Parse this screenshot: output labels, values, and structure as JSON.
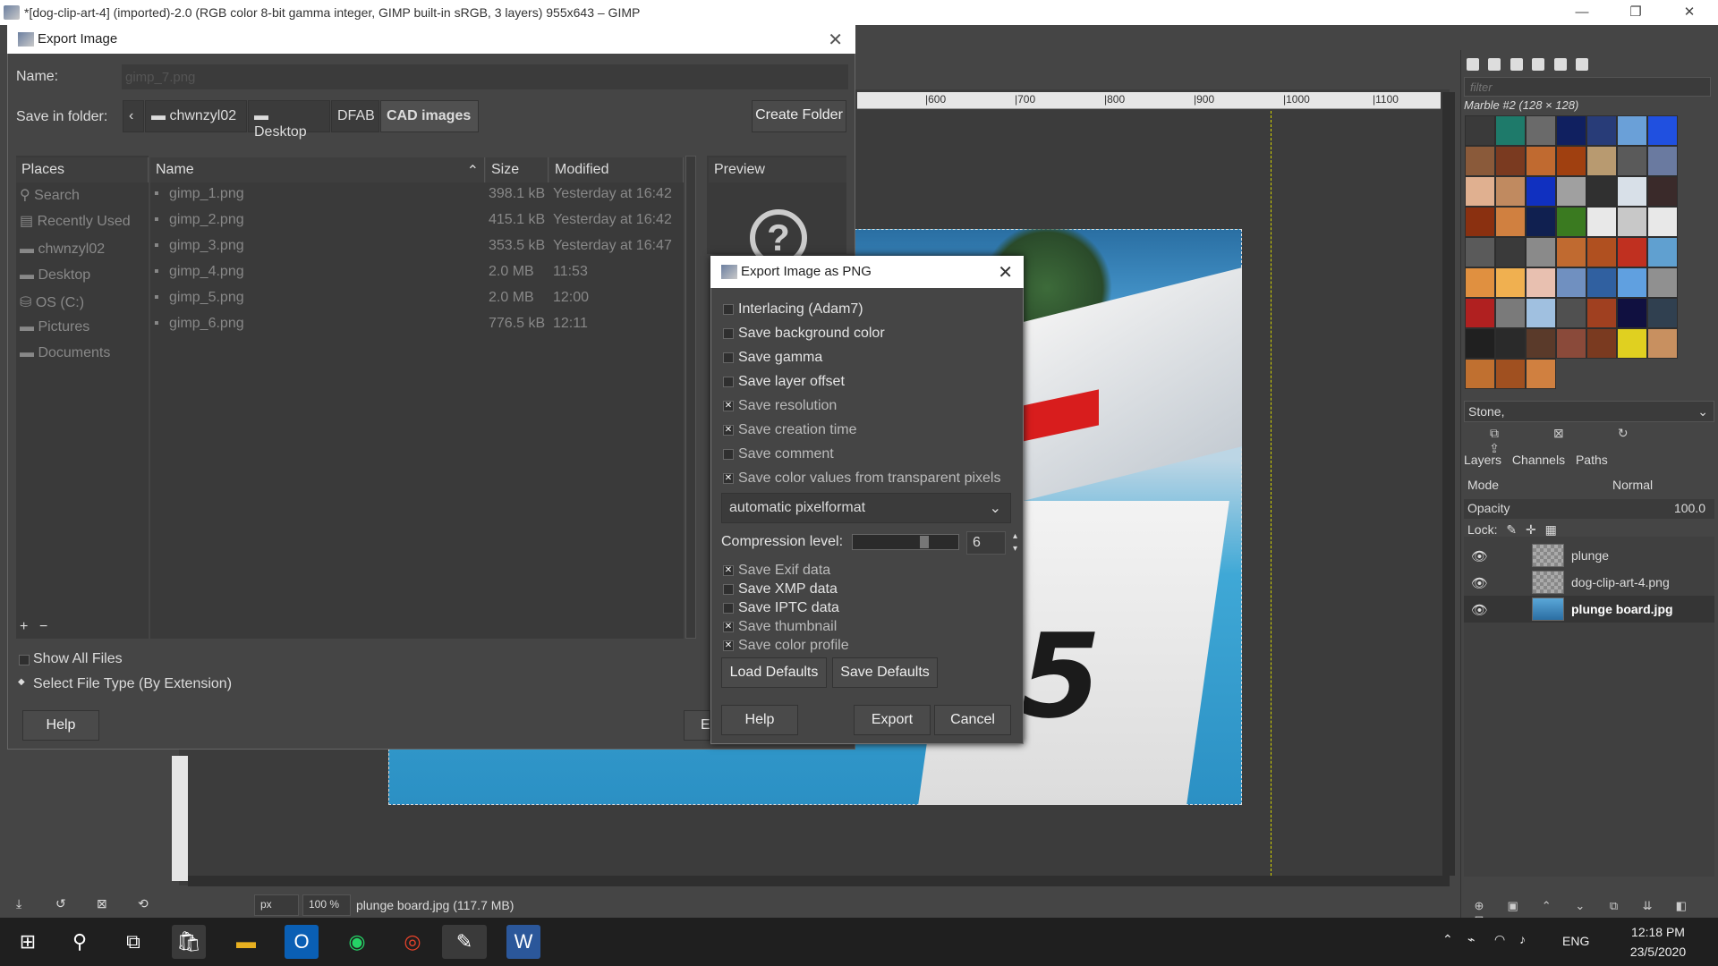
{
  "window": {
    "title": "*[dog-clip-art-4] (imported)-2.0 (RGB color 8-bit gamma integer, GIMP built-in sRGB, 3 layers) 955x643 – GIMP",
    "minimize": "—",
    "restore": "❐",
    "close": "✕"
  },
  "ruler": {
    "ticks": [
      "|600",
      "|700",
      "|800",
      "|900",
      "|1000",
      "|1100"
    ]
  },
  "status": {
    "unit": "px",
    "zoom": "100 %",
    "text": "plunge board.jpg (117.7 MB)"
  },
  "export_dialog": {
    "title": "Export Image",
    "name_label": "Name:",
    "name_value": "gimp_7.png",
    "folder_label": "Save in folder:",
    "crumbs": [
      "chwnzyl02",
      "Desktop",
      "DFAB",
      "CAD images"
    ],
    "create_folder": "Create Folder",
    "places_header": "Places",
    "places": [
      "Search",
      "Recently Used",
      "chwnzyl02",
      "Desktop",
      "OS (C:)",
      "Pictures",
      "Documents"
    ],
    "columns": {
      "name": "Name",
      "size": "Size",
      "modified": "Modified"
    },
    "files": [
      {
        "name": "gimp_1.png",
        "size": "398.1 kB",
        "modified": "Yesterday at 16:42"
      },
      {
        "name": "gimp_2.png",
        "size": "415.1 kB",
        "modified": "Yesterday at 16:42"
      },
      {
        "name": "gimp_3.png",
        "size": "353.5 kB",
        "modified": "Yesterday at 16:47"
      },
      {
        "name": "gimp_4.png",
        "size": "2.0 MB",
        "modified": "11:53"
      },
      {
        "name": "gimp_5.png",
        "size": "2.0 MB",
        "modified": "12:00"
      },
      {
        "name": "gimp_6.png",
        "size": "776.5 kB",
        "modified": "12:11"
      }
    ],
    "preview_header": "Preview",
    "show_all_files": "Show All Files",
    "select_file_type": "Select File Type (By Extension)",
    "help": "Help",
    "export_partial": "E"
  },
  "png_dialog": {
    "title": "Export Image as PNG",
    "options": [
      {
        "label": "Interlacing (Adam7)",
        "checked": false
      },
      {
        "label": "Save background color",
        "checked": false
      },
      {
        "label": "Save gamma",
        "checked": false
      },
      {
        "label": "Save layer offset",
        "checked": false
      },
      {
        "label": "Save resolution",
        "checked": true
      },
      {
        "label": "Save creation time",
        "checked": true
      },
      {
        "label": "Save comment",
        "checked": false
      },
      {
        "label": "Save color values from transparent pixels",
        "checked": true
      }
    ],
    "pixelformat": "automatic pixelformat",
    "compression_label": "Compression level:",
    "compression_value": "6",
    "compression_fraction": 0.67,
    "metadata": [
      {
        "label": "Save Exif data",
        "checked": true
      },
      {
        "label": "Save XMP data",
        "checked": false
      },
      {
        "label": "Save IPTC data",
        "checked": false
      },
      {
        "label": "Save thumbnail",
        "checked": true
      },
      {
        "label": "Save color profile",
        "checked": true
      }
    ],
    "load_defaults": "Load Defaults",
    "save_defaults": "Save Defaults",
    "help": "Help",
    "export": "Export",
    "cancel": "Cancel"
  },
  "dock": {
    "filter_placeholder": "filter",
    "pattern_name": "Marble #2 (128 × 128)",
    "pattern_select": "Stone,",
    "pattern_colors": [
      "#3a3a3a",
      "#1e7a6a",
      "#6a6a6a",
      "#102060",
      "#283c78",
      "#6aa0d8",
      "#2050e0",
      "#8a5a3a",
      "#7a3a20",
      "#c06a30",
      "#a04010",
      "#b89a70",
      "#5a5a5a",
      "#6a7aa0",
      "#e0b090",
      "#c08a60",
      "#1030c0",
      "#a0a0a0",
      "#303030",
      "#d8e0e8",
      "#3a2a2a",
      "#8a3010",
      "#d08040",
      "#102050",
      "#3a7a20",
      "#e8e8e8",
      "#c8c8c8",
      "#e8e8e8",
      "#5a5a5a",
      "#3a3a3a",
      "#8a8a8a",
      "#c06a30",
      "#b05020",
      "#c03020",
      "#60a0d0",
      "#e09040",
      "#f0b050",
      "#e8c0b0",
      "#7090c0",
      "#3060a0",
      "#60a0e0",
      "#909090",
      "#b02020",
      "#7a7a7a",
      "#a0c0e0",
      "#505050",
      "#a04020",
      "#101040",
      "#304050",
      "#202020",
      "#2a2a2a",
      "#5a3a2a",
      "#8a4a3a",
      "#7a3a20",
      "#e0d020",
      "#c89060",
      "#c07030",
      "#a05020",
      "#d08040"
    ],
    "tabs": [
      "Layers",
      "Channels",
      "Paths"
    ],
    "mode_label": "Mode",
    "mode_value": "Normal",
    "opacity_label": "Opacity",
    "opacity_value": "100.0",
    "lock_label": "Lock:",
    "layers": [
      {
        "name": "plunge",
        "bold": false
      },
      {
        "name": "dog-clip-art-4.png",
        "bold": false
      },
      {
        "name": "plunge board.jpg",
        "bold": true
      }
    ]
  },
  "taskbar": {
    "time": "12:18 PM",
    "date": "23/5/2020",
    "lang": "ENG"
  }
}
